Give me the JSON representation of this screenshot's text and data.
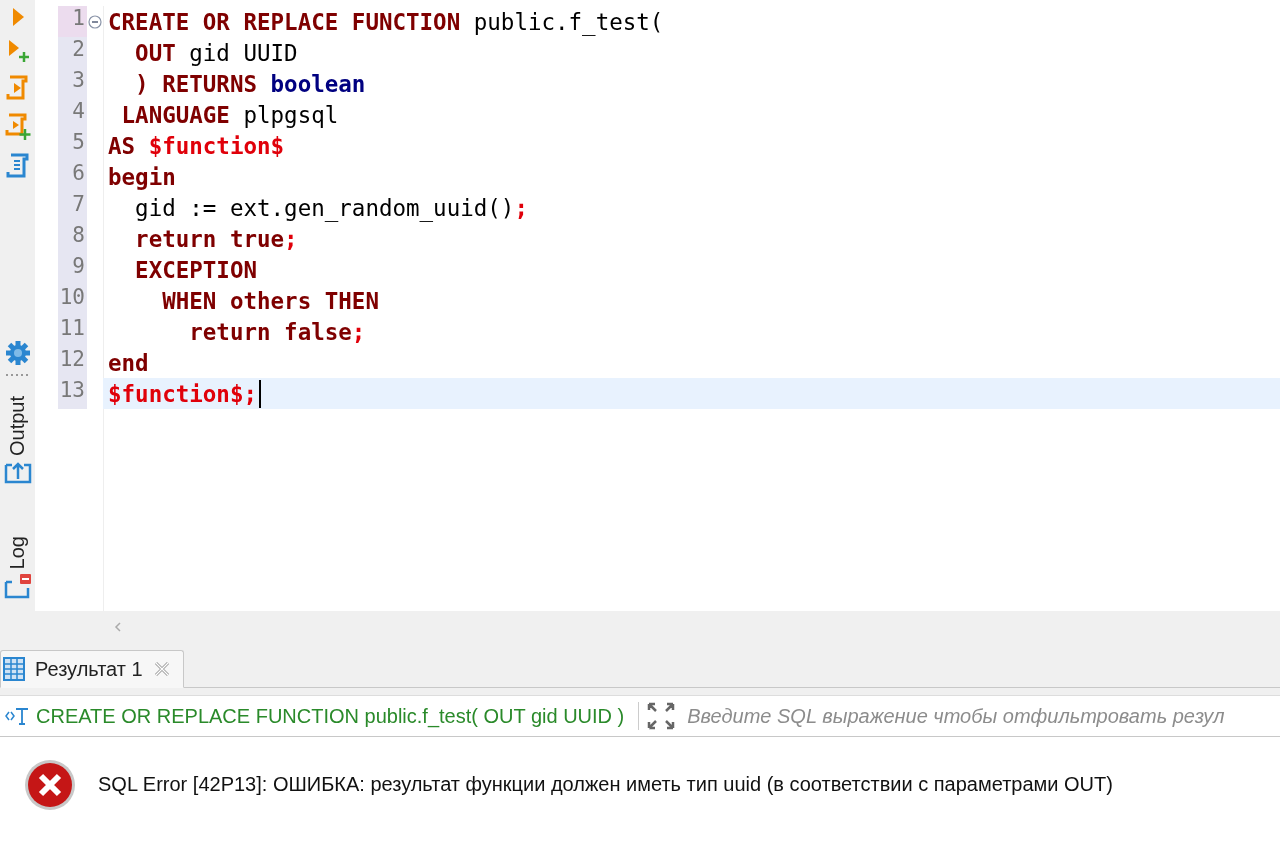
{
  "side_toolbar": {
    "panels": [
      {
        "label": "Output",
        "kind": "output"
      },
      {
        "label": "Log",
        "kind": "log"
      }
    ]
  },
  "editor": {
    "lines": [
      {
        "number": "1",
        "current": false,
        "foldable": true,
        "segments": [
          {
            "text": "CREATE OR REPLACE FUNCTION",
            "kind": "keyword"
          },
          {
            "text": " public.f_test(",
            "kind": "plain"
          }
        ]
      },
      {
        "number": "2",
        "current": false,
        "foldable": false,
        "segments": [
          {
            "text": "  OUT",
            "kind": "keyword"
          },
          {
            "text": " gid UUID",
            "kind": "plain"
          }
        ]
      },
      {
        "number": "3",
        "current": false,
        "foldable": false,
        "segments": [
          {
            "text": "  ) RETURNS ",
            "kind": "keyword"
          },
          {
            "text": "boolean",
            "kind": "type"
          }
        ]
      },
      {
        "number": "4",
        "current": false,
        "foldable": false,
        "segments": [
          {
            "text": " LANGUAGE",
            "kind": "keyword"
          },
          {
            "text": " plpgsql",
            "kind": "plain"
          }
        ]
      },
      {
        "number": "5",
        "current": false,
        "foldable": false,
        "segments": [
          {
            "text": "AS ",
            "kind": "keyword"
          },
          {
            "text": "$function$",
            "kind": "string"
          }
        ]
      },
      {
        "number": "6",
        "current": false,
        "foldable": false,
        "segments": [
          {
            "text": "begin",
            "kind": "keyword"
          }
        ]
      },
      {
        "number": "7",
        "current": false,
        "foldable": false,
        "segments": [
          {
            "text": "  gid := ext.gen_random_uuid()",
            "kind": "plain"
          },
          {
            "text": ";",
            "kind": "punct"
          }
        ]
      },
      {
        "number": "8",
        "current": false,
        "foldable": false,
        "segments": [
          {
            "text": "  return true",
            "kind": "keyword"
          },
          {
            "text": ";",
            "kind": "punct"
          }
        ]
      },
      {
        "number": "9",
        "current": false,
        "foldable": false,
        "segments": [
          {
            "text": "  EXCEPTION",
            "kind": "keyword"
          }
        ]
      },
      {
        "number": "10",
        "current": false,
        "foldable": false,
        "segments": [
          {
            "text": "    WHEN others THEN",
            "kind": "keyword"
          }
        ]
      },
      {
        "number": "11",
        "current": false,
        "foldable": false,
        "segments": [
          {
            "text": "      return false",
            "kind": "keyword"
          },
          {
            "text": ";",
            "kind": "punct"
          }
        ]
      },
      {
        "number": "12",
        "current": false,
        "foldable": false,
        "segments": [
          {
            "text": "end",
            "kind": "keyword"
          }
        ]
      },
      {
        "number": "13",
        "current": true,
        "foldable": false,
        "segments": [
          {
            "text": "$function$;",
            "kind": "string"
          }
        ]
      }
    ]
  },
  "results": {
    "tabs": [
      {
        "label": "Результат 1",
        "selected": true
      }
    ],
    "query": "CREATE OR REPLACE FUNCTION public.f_test( OUT gid UUID )",
    "filter": {
      "placeholder": "Введите SQL выражение чтобы отфильтровать резул"
    },
    "error": "SQL Error [42P13]: ОШИБКА: результат функции должен иметь тип uuid (в соответствии с параметрами OUT)"
  }
}
